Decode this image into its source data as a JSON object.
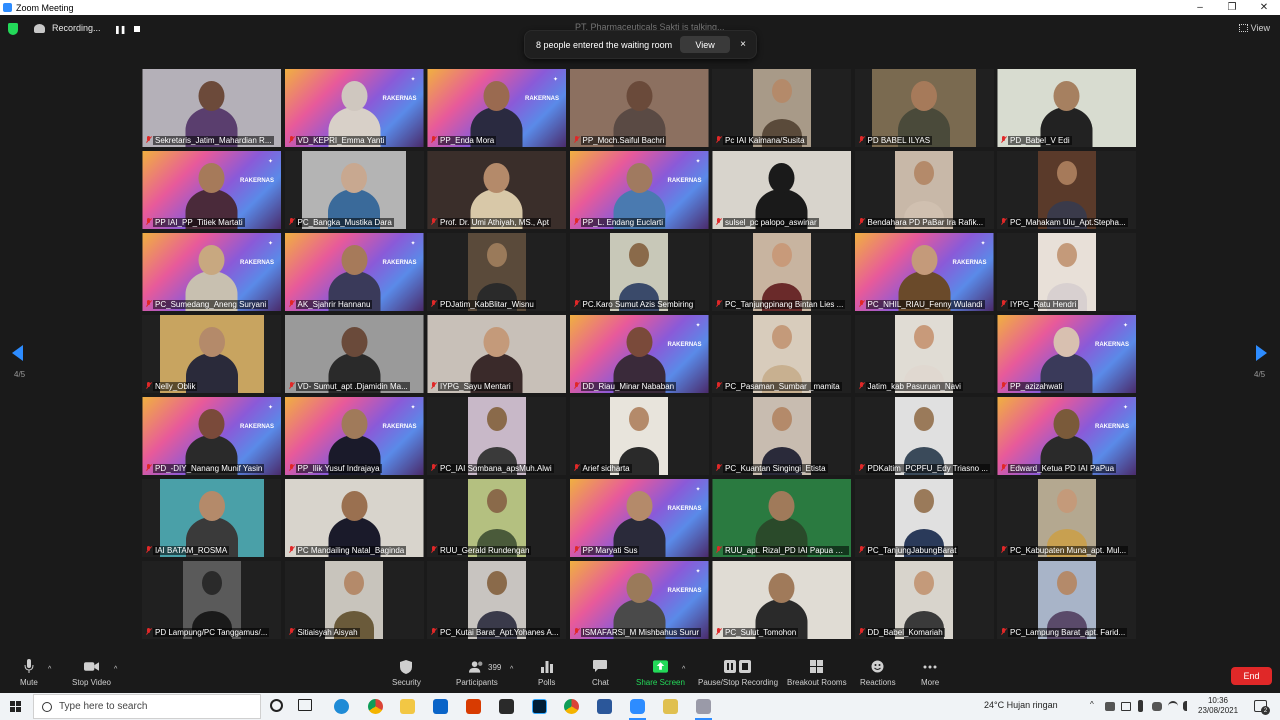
{
  "window": {
    "title": "Zoom Meeting",
    "controls": [
      "–",
      "❐",
      "✕"
    ]
  },
  "topbar": {
    "recording_label": "Recording...",
    "talking_label": "PT. Pharmaceuticals Sakti is talking...",
    "view_label": "View"
  },
  "notification": {
    "message": "8 people entered the waiting room",
    "view_label": "View",
    "close_label": "×"
  },
  "pager": {
    "left": "4/5",
    "right": "4/5"
  },
  "participants": [
    {
      "name": "Sekretaris_Jatim_Mahardian R...",
      "variant": "full",
      "bg": "#b4b0b8",
      "head": "#6c4a3a",
      "body": "#5a3e6e",
      "rakernas": false
    },
    {
      "name": "VD_KEPRI_Emma Yanti",
      "variant": "full",
      "bg": "rakernas",
      "head": "#cfc7bf",
      "body": "#d8d0c8",
      "rakernas": true
    },
    {
      "name": "PP_Enda Mora",
      "variant": "full",
      "bg": "rakernas",
      "head": "#9a6a50",
      "body": "#2a2a40",
      "rakernas": true
    },
    {
      "name": "PP_Moch.Saiful Bachri",
      "variant": "full",
      "bg": "#8c7060",
      "head": "#6a4a3a",
      "body": "#5a4a44",
      "rakernas": false
    },
    {
      "name": "Pc IAI Kaimana/Susita",
      "variant": "narrow",
      "bg": "#a89a88",
      "head": "#b48a6a",
      "body": "#5a4a3a",
      "rakernas": false
    },
    {
      "name": "PD BABEL ILYAS",
      "variant": "mid",
      "bg": "#7a6a50",
      "head": "#a67a5a",
      "body": "#4a4a3a",
      "rakernas": false
    },
    {
      "name": "PD_Babel_V Edi",
      "variant": "full",
      "bg": "#d8dcd0",
      "head": "#a68060",
      "body": "#222222",
      "rakernas": false
    },
    {
      "name": "PP IAI_PP_Titiek Martati",
      "variant": "full",
      "bg": "rakernas",
      "head": "#a67a5a",
      "body": "#4a2a3a",
      "rakernas": true
    },
    {
      "name": "PC_Bangka_Mustika Dara",
      "variant": "mid",
      "bg": "#b4b4b4",
      "head": "#c8a890",
      "body": "#3a6a9a",
      "rakernas": false
    },
    {
      "name": "Prof. Dr. Umi Athiyah, MS., Apt",
      "variant": "full",
      "bg": "#3a2e2a",
      "head": "#b48a6a",
      "body": "#d8c8a8",
      "rakernas": false
    },
    {
      "name": "PP_L. Endang Euclarti",
      "variant": "full",
      "bg": "rakernas",
      "head": "#a07a60",
      "body": "#4a7ab0",
      "rakernas": true
    },
    {
      "name": "sulsel_pc palopo_aswinar",
      "variant": "full",
      "bg": "#d8d4cc",
      "head": "#1a1a1a",
      "body": "#1a1a1a",
      "rakernas": false
    },
    {
      "name": "Bendahara PD PaBar Ira Rafik...",
      "variant": "narrow",
      "bg": "#c8b8a8",
      "head": "#b48a6a",
      "body": "#d0c0b0",
      "rakernas": false
    },
    {
      "name": "PC_Mahakam Ulu_Apt.Stepha...",
      "variant": "narrow",
      "bg": "#5a3a2a",
      "head": "#a67a5a",
      "body": "#3a3a4a",
      "rakernas": false
    },
    {
      "name": "PC_Sumedang_Aneng Suryani",
      "variant": "full",
      "bg": "rakernas",
      "head": "#c8a880",
      "body": "#c8c0b0",
      "rakernas": true
    },
    {
      "name": "AK_Sjahrir Hannanu",
      "variant": "full",
      "bg": "rakernas",
      "head": "#a67a5a",
      "body": "#3a3a5a",
      "rakernas": true
    },
    {
      "name": "PDJatim_KabBlitar_Wisnu",
      "variant": "narrow",
      "bg": "#5a4a3a",
      "head": "#9a7a5a",
      "body": "#2a2a2a",
      "rakernas": false
    },
    {
      "name": "PC.Karo Sumut Azis Sembiring",
      "variant": "narrow",
      "bg": "#c8c8b8",
      "head": "#8a6a4a",
      "body": "#3a4a6a",
      "rakernas": false
    },
    {
      "name": "PC_Tanjungpinang Bintan Lies ...",
      "variant": "narrow",
      "bg": "#c8b4a0",
      "head": "#c89a7a",
      "body": "#6a2a2a",
      "rakernas": false
    },
    {
      "name": "PC_NHIL_RIAU_Fenny Wulandi",
      "variant": "full",
      "bg": "rakernas",
      "head": "#c49a7a",
      "body": "#6a4a2a",
      "rakernas": true
    },
    {
      "name": "IYPG_Ratu Hendri",
      "variant": "narrow",
      "bg": "#e8e0d8",
      "head": "#c49a7a",
      "body": "#d8d0d0",
      "rakernas": false
    },
    {
      "name": "Nelly_Oblik",
      "variant": "mid",
      "bg": "#c8a460",
      "head": "#b48a6a",
      "body": "#2a2a3a",
      "rakernas": false
    },
    {
      "name": "VD- Sumut_apt .Djamidin Ma...",
      "variant": "full",
      "bg": "#9a9a9a",
      "head": "#6a4a3a",
      "body": "#2a2a2a",
      "rakernas": false
    },
    {
      "name": "IYPG_Sayu Mentari",
      "variant": "full",
      "bg": "#c8c0b8",
      "head": "#c49a7a",
      "body": "#3a2a2a",
      "rakernas": false
    },
    {
      "name": "DD_Riau_Minar Nababan",
      "variant": "full",
      "bg": "rakernas",
      "head": "#7a4a3a",
      "body": "#3a2a3a",
      "rakernas": true
    },
    {
      "name": "PC_Pasaman_Sumbar _mamita",
      "variant": "narrow",
      "bg": "#d8ccbc",
      "head": "#c49a7a",
      "body": "#c8b090",
      "rakernas": false
    },
    {
      "name": "Jatim_kab Pasuruan_Navi",
      "variant": "narrow",
      "bg": "#e0dcd4",
      "head": "#c89a7a",
      "body": "#e0d8d0",
      "rakernas": false
    },
    {
      "name": "PP_azizahwati",
      "variant": "full",
      "bg": "rakernas",
      "head": "#d8c0b0",
      "body": "#3a3a5a",
      "rakernas": true
    },
    {
      "name": "PD_-DIY_Nanang Munif Yasin",
      "variant": "full",
      "bg": "rakernas",
      "head": "#7a4a3a",
      "body": "#2a2a2a",
      "rakernas": true
    },
    {
      "name": "PP_Ilik Yusuf Indrajaya",
      "variant": "full",
      "bg": "rakernas",
      "head": "#a07a5a",
      "body": "#1a1a2a",
      "rakernas": true
    },
    {
      "name": "PC_IAI Sombana_apsMuh.Alwi",
      "variant": "narrow",
      "bg": "#c8b8c8",
      "head": "#8a6a4a",
      "body": "#3a3a3a",
      "rakernas": false
    },
    {
      "name": "Arief sidharta",
      "variant": "narrow",
      "bg": "#e8e4dc",
      "head": "#b48a6a",
      "body": "#2a2a2a",
      "rakernas": false
    },
    {
      "name": "PC_Kuantan Singingi_Etista",
      "variant": "narrow",
      "bg": "#c8bcb0",
      "head": "#b48a6a",
      "body": "#2a2a3a",
      "rakernas": false
    },
    {
      "name": "PDKaltim_PCPFU_Edy Triasno ...",
      "variant": "narrow",
      "bg": "#e0e0e0",
      "head": "#9a7a5a",
      "body": "#3a4a5a",
      "rakernas": false
    },
    {
      "name": "Edward_Ketua PD IAI PaPua",
      "variant": "full",
      "bg": "rakernas",
      "head": "#7a5a3a",
      "body": "#2a2a2a",
      "rakernas": true
    },
    {
      "name": "IAI BATAM_ROSMA",
      "variant": "mid",
      "bg": "#4aa0a8",
      "head": "#b48a6a",
      "body": "#3a3a3a",
      "rakernas": false
    },
    {
      "name": "PC Mandailing Natal_Baginda",
      "variant": "full",
      "bg": "#d8d4cc",
      "head": "#9a7050",
      "body": "#1a1a2a",
      "rakernas": false
    },
    {
      "name": "RUU_Gerald Rundengan",
      "variant": "narrow",
      "bg": "#b4c080",
      "head": "#8a6a4a",
      "body": "#4a5a3a",
      "rakernas": false
    },
    {
      "name": "PP Maryati Sus",
      "variant": "full",
      "bg": "rakernas",
      "head": "#b48a6a",
      "body": "#2a2a3a",
      "rakernas": true
    },
    {
      "name": "RUU_apt. Rizal_PD IAI Papua B...",
      "variant": "full",
      "bg": "#2a7a40",
      "head": "#a07a5a",
      "body": "#2a4a2a",
      "rakernas": false
    },
    {
      "name": "PC_TanjungJabungBarat",
      "variant": "narrow",
      "bg": "#e0e0e0",
      "head": "#9a7a5a",
      "body": "#2a3a5a",
      "rakernas": false
    },
    {
      "name": "PC_Kabupaten Muna_apt. Mul...",
      "variant": "narrow",
      "bg": "#b4a890",
      "head": "#c49a7a",
      "body": "#c8a050",
      "rakernas": false
    },
    {
      "name": "PD Lampung/PC Tanggamus/...",
      "variant": "narrow",
      "bg": "#5a5a5a",
      "head": "#2a2a2a",
      "body": "#1a1a1a",
      "rakernas": false
    },
    {
      "name": "Sitiaisyah Aisyah",
      "variant": "narrow",
      "bg": "#c8c4bc",
      "head": "#b48a6a",
      "body": "#6a5a3a",
      "rakernas": false
    },
    {
      "name": "PC_Kutai Barat_Apt.Yohanes A...",
      "variant": "narrow",
      "bg": "#c8c4c0",
      "head": "#8a6a4a",
      "body": "#3a3a4a",
      "rakernas": false
    },
    {
      "name": "ISMAFARSI_M Mishbahus Surur",
      "variant": "full",
      "bg": "rakernas",
      "head": "#9a7a5a",
      "body": "#4a4a4a",
      "rakernas": true
    },
    {
      "name": "PC_Sulut_Tomohon",
      "variant": "full",
      "bg": "#e0dcd4",
      "head": "#a07a5a",
      "body": "#2a2a2a",
      "rakernas": false
    },
    {
      "name": "DD_Babel_Komariah",
      "variant": "narrow",
      "bg": "#d8d4cc",
      "head": "#c49a7a",
      "body": "#3a3a3a",
      "rakernas": false
    },
    {
      "name": "PC_Lampung Barat_apt. Farid...",
      "variant": "narrow",
      "bg": "#a8b4c8",
      "head": "#b48a6a",
      "body": "#5a4a6a",
      "rakernas": false
    }
  ],
  "rakernas_text": "RAKERNAS",
  "toolbar": {
    "mute": "Mute",
    "stop_video": "Stop Video",
    "security": "Security",
    "participants": "Participants",
    "participants_count": "399",
    "polls": "Polls",
    "chat": "Chat",
    "share_screen": "Share Screen",
    "pause_recording": "Pause/Stop Recording",
    "breakout_rooms": "Breakout Rooms",
    "reactions": "Reactions",
    "more": "More",
    "end": "End"
  },
  "taskbar": {
    "search_placeholder": "Type here to search",
    "weather": "24°C  Hujan ringan",
    "time": "10:36",
    "date": "23/08/2021",
    "notification_count": "2"
  }
}
